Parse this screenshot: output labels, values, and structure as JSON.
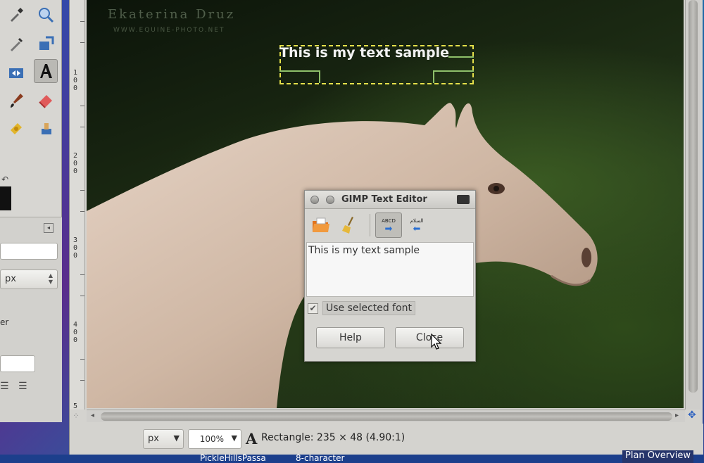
{
  "watermark": {
    "name": "Ekaterina Druz",
    "url": "WWW.EQUINE-PHOTO.NET"
  },
  "canvas": {
    "text_layer": "This is my text sample"
  },
  "ruler": {
    "marks": [
      "1\n0\n0",
      "2\n0\n0",
      "3\n0\n0",
      "4\n0\n0",
      "5"
    ]
  },
  "tool_options": {
    "unit": "px",
    "label_fragment": "er"
  },
  "dialog": {
    "title": "GIMP Text Editor",
    "text": "This is my text sample",
    "use_selected_font_label": "Use selected font",
    "use_selected_font_checked": true,
    "help_label": "Help",
    "close_label": "Close",
    "ltr_label": "ABCD",
    "rtl_label": "السلام"
  },
  "statusbar": {
    "unit": "px",
    "zoom": "100%",
    "message": "Rectangle: 235 × 48  (4.90:1)"
  },
  "taskbar": {
    "items": [
      "PickleHillsPassa",
      "8-character"
    ],
    "plan_overview": "Plan Overview"
  },
  "colors": {
    "selection_dash": "#e5e04a",
    "handle_green": "#8ec06a",
    "chrome": "#d4d3cf"
  }
}
